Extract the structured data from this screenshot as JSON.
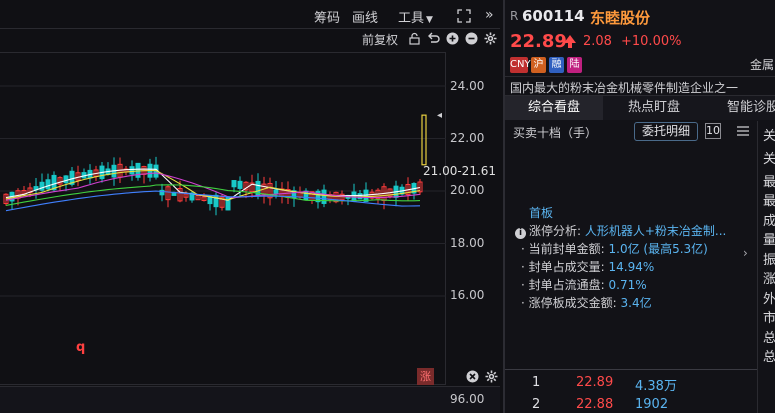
{
  "toolbar": {
    "chips_label": "筹码",
    "draw_label": "画线",
    "tools_label": "工具",
    "adjust_label": "前复权"
  },
  "chart": {
    "y_ticks": [
      "24.00",
      "22.00",
      "20.00",
      "18.00",
      "16.00"
    ],
    "price_range_label": "21.00-21.61",
    "q_marker": "q",
    "limit_up_marker": "涨",
    "lower_tick": "96.00",
    "colors": {
      "up": "#ff3b3b",
      "down": "#19c8c8",
      "ma5": "#ffffff",
      "ma10": "#e8e040",
      "ma20": "#d040d0",
      "ma60": "#40d040",
      "ma120": "#4080ff"
    }
  },
  "stock": {
    "market_prefix": "R",
    "code": "600114",
    "name": "东睦股份",
    "price": "22.89",
    "change": "2.08",
    "change_pct": "+10.00%",
    "badges": [
      {
        "text": "CNY",
        "color": "#c03030"
      },
      {
        "text": "沪",
        "color": "#d06020"
      },
      {
        "text": "融",
        "color": "#3060c0"
      },
      {
        "text": "陆",
        "color": "#c02080"
      }
    ],
    "badge_more": "金属",
    "description": "国内最大的粉末冶金机械零件制造企业之一"
  },
  "tabs": [
    {
      "label": "综合看盘",
      "active": true
    },
    {
      "label": "热点盯盘",
      "active": false
    },
    {
      "label": "智能诊股",
      "active": false
    }
  ],
  "depth": {
    "title": "买卖十档（手）",
    "entrust_label": "委托明细",
    "entrust_count": "10"
  },
  "limit_up": {
    "title": "首板",
    "analysis_label": "涨停分析:",
    "analysis_value": "人形机器人+粉末冶金制...",
    "metrics": [
      {
        "label": "当前封单金额:",
        "value": "1.0亿 (最高5.3亿)"
      },
      {
        "label": "封单占成交量:",
        "value": "14.94%"
      },
      {
        "label": "封单占流通盘:",
        "value": "0.71%"
      },
      {
        "label": "涨停板成交金额:",
        "value": "3.4亿"
      }
    ]
  },
  "orders": [
    {
      "index": "1",
      "price": "22.89",
      "volume": "4.38万"
    },
    {
      "index": "2",
      "price": "22.88",
      "volume": "1902"
    }
  ],
  "side_column": [
    "关",
    "关",
    "最",
    "最",
    "成",
    "量",
    "振",
    "涨",
    "外",
    "市",
    "总",
    "总"
  ]
}
